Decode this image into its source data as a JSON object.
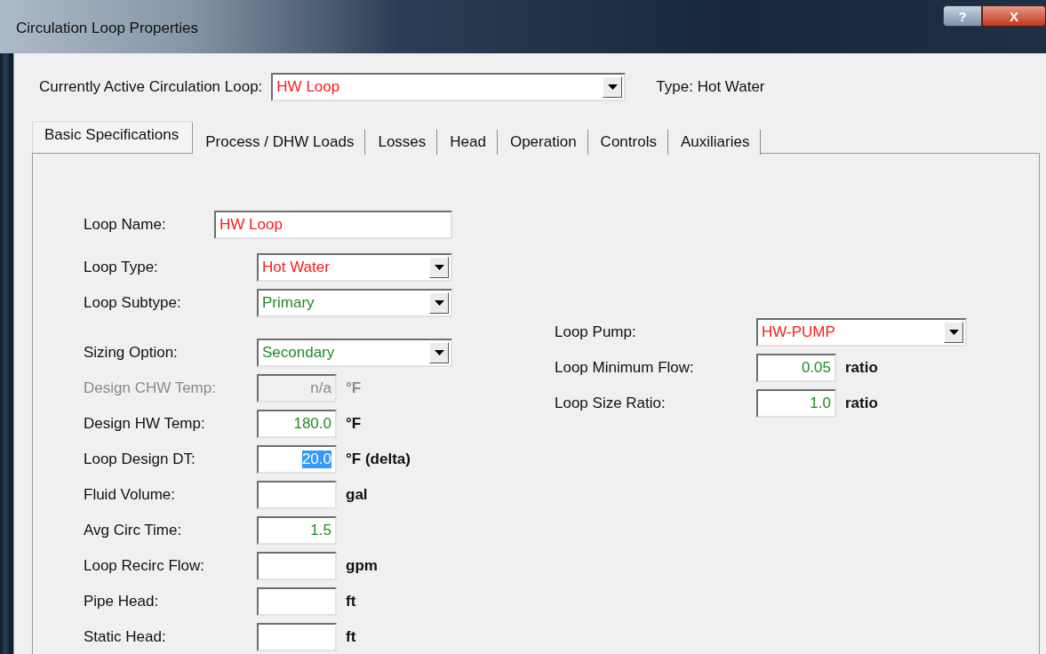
{
  "window": {
    "title": "Circulation Loop Properties",
    "help_button": "?",
    "close_button": "X"
  },
  "active_loop": {
    "label": "Currently Active Circulation Loop:",
    "value": "HW Loop",
    "color": "#ff1a1a",
    "type_text": "Type: Hot Water"
  },
  "tabs": [
    {
      "label": "Basic Specifications",
      "selected": true
    },
    {
      "label": "Process / DHW Loads",
      "selected": false
    },
    {
      "label": "Losses",
      "selected": false
    },
    {
      "label": "Head",
      "selected": false
    },
    {
      "label": "Operation",
      "selected": false
    },
    {
      "label": "Controls",
      "selected": false
    },
    {
      "label": "Auxiliaries",
      "selected": false
    }
  ],
  "left_groups": [
    [
      {
        "label": "Loop Name:",
        "kind": "name",
        "value": "HW Loop",
        "color": "#ff1a1a",
        "disabled": false,
        "highlighted": false
      }
    ],
    [
      {
        "label": "Loop Type:",
        "kind": "dropdown",
        "value": "Hot Water",
        "color": "#ff1a1a",
        "disabled": false,
        "highlighted": false
      },
      {
        "label": "Loop Subtype:",
        "kind": "dropdown",
        "value": "Primary",
        "color": "#1e8c1e",
        "disabled": false,
        "highlighted": false
      }
    ],
    [
      {
        "label": "Sizing Option:",
        "kind": "dropdown",
        "value": "Secondary",
        "color": "#1e8c1e",
        "disabled": false,
        "highlighted": false
      },
      {
        "label": "Design CHW Temp:",
        "kind": "number",
        "value": "n/a",
        "color": "#8a8a8a",
        "unit": "°F",
        "disabled": true,
        "highlighted": false
      },
      {
        "label": "Design HW Temp:",
        "kind": "number",
        "value": "180.0",
        "color": "#1e8c1e",
        "unit": "°F",
        "disabled": false,
        "highlighted": false
      },
      {
        "label": "Loop Design DT:",
        "kind": "number",
        "value": "20.0",
        "color": "#ffffff",
        "unit": "°F (delta)",
        "disabled": false,
        "highlighted": true
      },
      {
        "label": "Fluid Volume:",
        "kind": "number",
        "unit": "gal",
        "disabled": false,
        "highlighted": false
      },
      {
        "label": "Avg Circ Time:",
        "kind": "number",
        "value": "1.5",
        "color": "#1e8c1e",
        "disabled": false,
        "highlighted": false
      },
      {
        "label": "Loop Recirc Flow:",
        "kind": "number",
        "unit": "gpm",
        "disabled": false,
        "highlighted": false
      },
      {
        "label": "Pipe Head:",
        "kind": "number",
        "unit": "ft",
        "disabled": false,
        "highlighted": false
      },
      {
        "label": "Static Head:",
        "kind": "number",
        "unit": "ft",
        "disabled": false,
        "highlighted": false
      }
    ]
  ],
  "right_fields": [
    {
      "label": "Loop Pump:",
      "kind": "dropdown",
      "value": "HW-PUMP",
      "color": "#ff1a1a",
      "disabled": false,
      "highlighted": false
    },
    {
      "label": "Loop Minimum Flow:",
      "kind": "number",
      "value": "0.05",
      "color": "#1e8c1e",
      "unit": "ratio",
      "disabled": false,
      "highlighted": false
    },
    {
      "label": "Loop Size Ratio:",
      "kind": "number",
      "value": "1.0",
      "color": "#1e8c1e",
      "unit": "ratio",
      "disabled": false,
      "highlighted": false
    }
  ]
}
